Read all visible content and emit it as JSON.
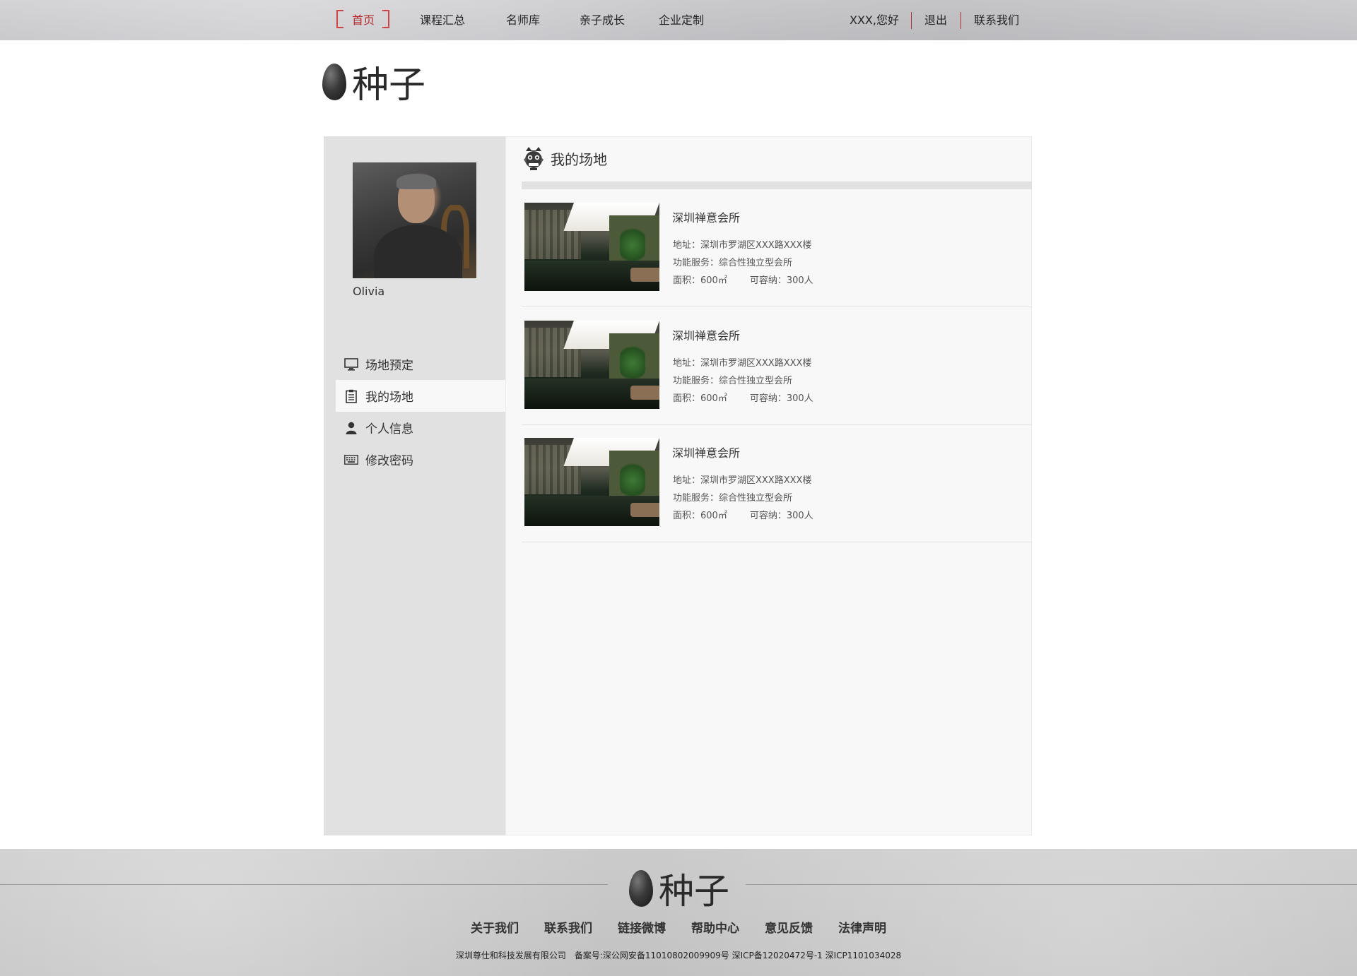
{
  "nav": {
    "items": [
      "首页",
      "课程汇总",
      "名师库",
      "亲子成长",
      "企业定制"
    ],
    "greeting": "XXX,您好",
    "logout": "退出",
    "contact": "联系我们"
  },
  "logo": {
    "text": "种子"
  },
  "sidebar": {
    "user_name": "Olivia",
    "menu": [
      {
        "label": "场地预定",
        "icon": "monitor-icon"
      },
      {
        "label": "我的场地",
        "icon": "clipboard-icon",
        "active": true
      },
      {
        "label": "个人信息",
        "icon": "person-icon"
      },
      {
        "label": "修改密码",
        "icon": "keyboard-icon"
      }
    ]
  },
  "main": {
    "title": "我的场地",
    "venues": [
      {
        "name": "深圳禅意会所",
        "address": "地址：深圳市罗湖区XXX路XXX楼",
        "service": "功能服务：综合性独立型会所",
        "area": "面积：600㎡",
        "capacity": "可容纳：300人"
      },
      {
        "name": "深圳禅意会所",
        "address": "地址：深圳市罗湖区XXX路XXX楼",
        "service": "功能服务：综合性独立型会所",
        "area": "面积：600㎡",
        "capacity": "可容纳：300人"
      },
      {
        "name": "深圳禅意会所",
        "address": "地址：深圳市罗湖区XXX路XXX楼",
        "service": "功能服务：综合性独立型会所",
        "area": "面积：600㎡",
        "capacity": "可容纳：300人"
      }
    ]
  },
  "footer": {
    "links": [
      "关于我们",
      "联系我们",
      "链接微博",
      "帮助中心",
      "意见反馈",
      "法律声明"
    ],
    "copyright": "深圳尊仕和科技发展有限公司　备案号:深公网安备11010802009909号 深ICP备12020472号-1 深ICP1101034028"
  },
  "colors": {
    "accent": "#b42b2b",
    "sidebar_bg": "#e1e1e1",
    "content_bg": "#f8f8f8"
  }
}
